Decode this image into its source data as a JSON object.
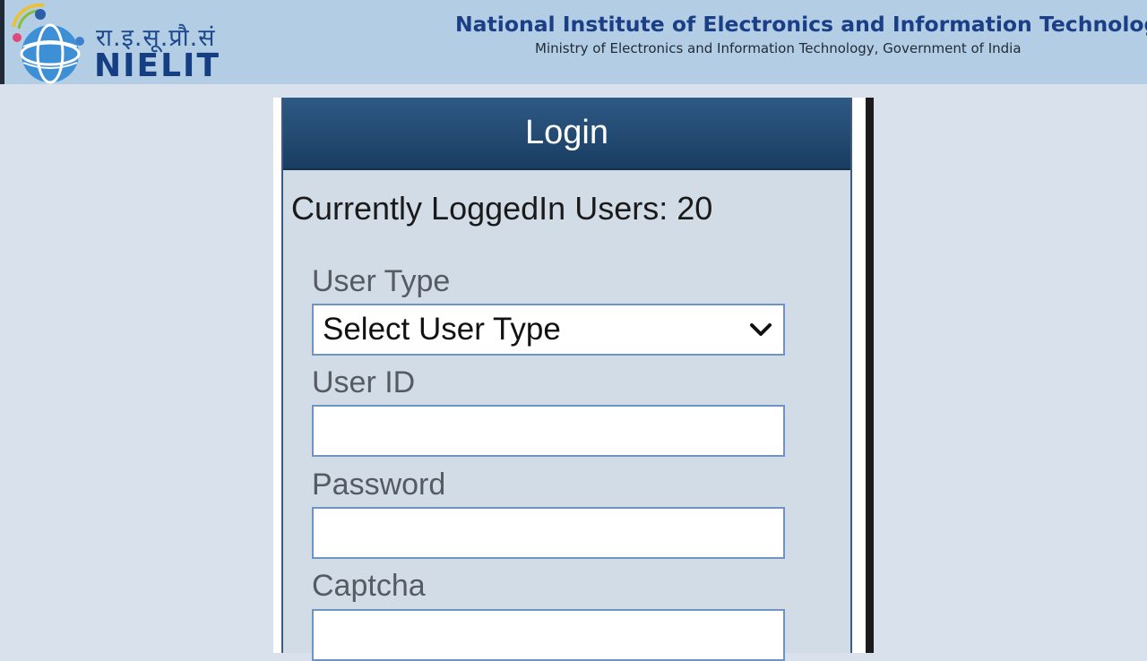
{
  "header": {
    "logo_hindi": "रा.इ.सू.प्रौ.सं",
    "logo_text": "NIELIT",
    "org_title": "National Institute of Electronics and Information Technology",
    "org_subtitle": "Ministry of Electronics and Information Technology, Government of India"
  },
  "login": {
    "title": "Login",
    "logged_in_label": "Currently LoggedIn Users: 20",
    "user_type_label": "User Type",
    "user_type_value": "Select User Type",
    "user_id_label": "User ID",
    "user_id_value": "",
    "password_label": "Password",
    "password_value": "",
    "captcha_label": "Captcha",
    "captcha_value": ""
  },
  "colors": {
    "header_bg": "#b3cde4",
    "page_bg": "#d9e1ec",
    "panel_header": "#1f4670",
    "panel_bg": "#d2dce6",
    "title_blue": "#1a3f86"
  },
  "icons": [
    "nielit-logo-icon",
    "chevron-down-icon"
  ]
}
